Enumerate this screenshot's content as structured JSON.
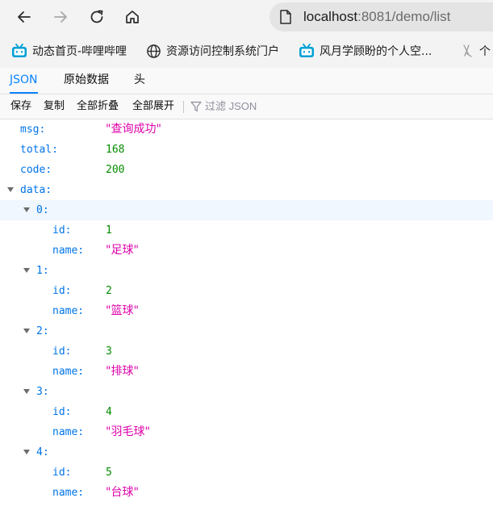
{
  "url": {
    "host": "localhost",
    "rest": ":8081/demo/list"
  },
  "bookmarks": [
    {
      "label": "动态首页-哔哩哔哩",
      "icon": "bilibili-icon"
    },
    {
      "label": "资源访问控制系统门户",
      "icon": "globe-icon"
    },
    {
      "label": "风月学顾盼的个人空...",
      "icon": "bilibili-icon"
    },
    {
      "label": "个",
      "icon": "page-icon"
    }
  ],
  "tabs": {
    "json": "JSON",
    "raw": "原始数据",
    "headers": "头"
  },
  "toolbar": {
    "save": "保存",
    "copy": "复制",
    "collapse_all": "全部折叠",
    "expand_all": "全部展开",
    "filter_placeholder": "过滤 JSON"
  },
  "json": {
    "msg": {
      "key": "msg:",
      "value": "\"查询成功\""
    },
    "total": {
      "key": "total:",
      "value": "168"
    },
    "code": {
      "key": "code:",
      "value": "200"
    },
    "data_key": "data:",
    "id_key": "id:",
    "name_key": "name:",
    "items": [
      {
        "index": "0:",
        "id": "1",
        "name": "\"足球\""
      },
      {
        "index": "1:",
        "id": "2",
        "name": "\"篮球\""
      },
      {
        "index": "2:",
        "id": "3",
        "name": "\"排球\""
      },
      {
        "index": "3:",
        "id": "4",
        "name": "\"羽毛球\""
      },
      {
        "index": "4:",
        "id": "5",
        "name": "\"台球\""
      }
    ]
  },
  "colors": {
    "key": "#0074e8",
    "string": "#dd00a9",
    "number": "#058b00",
    "accent": "#0a84ff",
    "bilibili": "#00a1d6"
  }
}
